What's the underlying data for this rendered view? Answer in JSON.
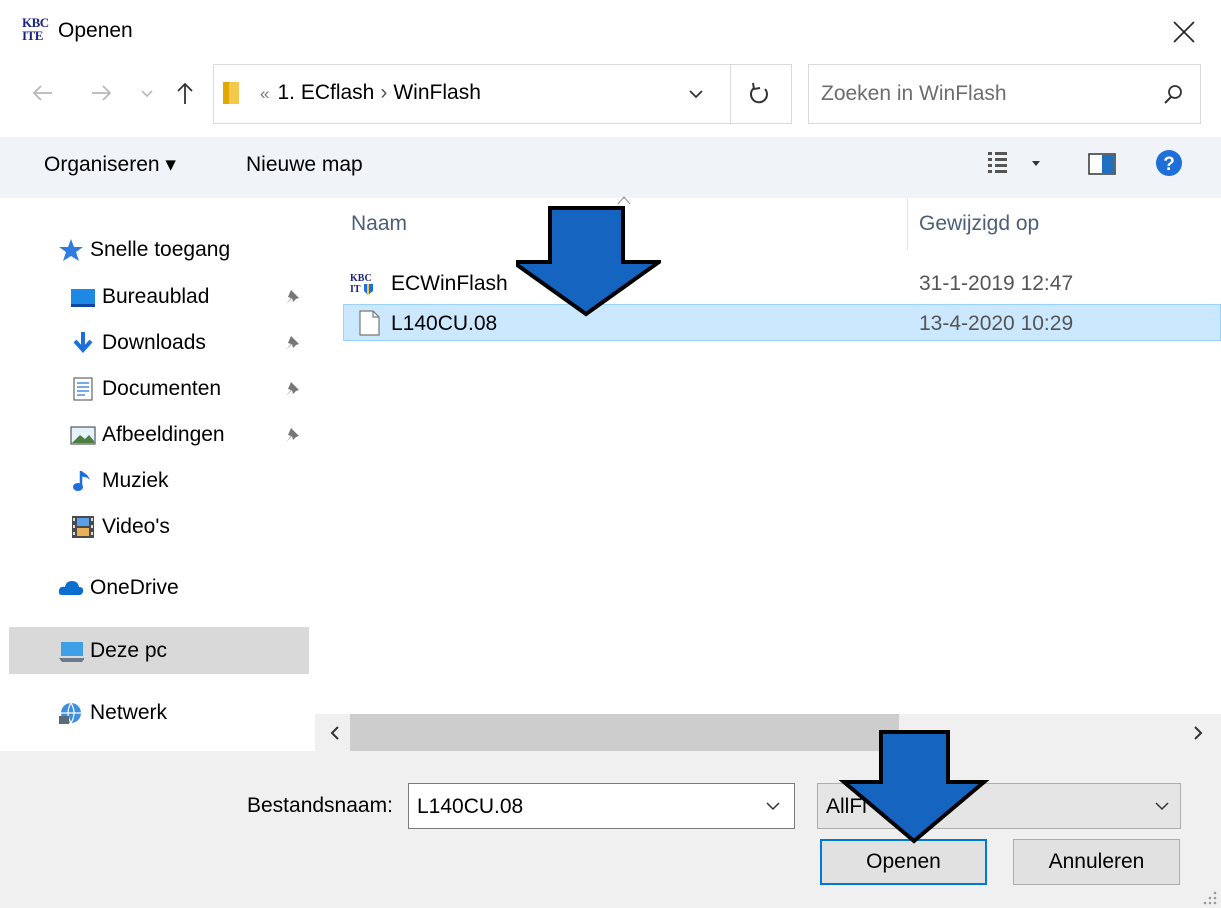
{
  "window": {
    "logo_text": [
      "KBC",
      "ITE"
    ],
    "title": "Openen",
    "close_label": "×"
  },
  "address": {
    "prefix": "«",
    "crumbs": [
      "1. ECflash",
      "WinFlash"
    ]
  },
  "search": {
    "placeholder": "Zoeken in WinFlash"
  },
  "toolbar": {
    "organise_label": "Organiseren ▾",
    "new_folder_label": "Nieuwe map"
  },
  "sidebar": {
    "items": [
      {
        "label": "Snelle toegang",
        "icon": "star-icon"
      },
      {
        "label": "Bureaublad",
        "icon": "desktop-icon",
        "pinned": true
      },
      {
        "label": "Downloads",
        "icon": "download-arrow-icon",
        "pinned": true
      },
      {
        "label": "Documenten",
        "icon": "document-icon",
        "pinned": true
      },
      {
        "label": "Afbeeldingen",
        "icon": "picture-icon",
        "pinned": true
      },
      {
        "label": "Muziek",
        "icon": "music-note-icon"
      },
      {
        "label": "Video's",
        "icon": "film-icon"
      },
      {
        "label": "OneDrive",
        "icon": "cloud-icon"
      },
      {
        "label": "Deze pc",
        "icon": "computer-icon",
        "selected": true
      },
      {
        "label": "Netwerk",
        "icon": "network-icon"
      }
    ]
  },
  "list": {
    "columns": [
      "Naam",
      "Gewijzigd op"
    ],
    "rows": [
      {
        "name": "ECWinFlash",
        "modified": "31-1-2019 12:47",
        "icon": "kbc-app-icon",
        "selected": false
      },
      {
        "name": "L140CU.08",
        "modified": "13-4-2020 10:29",
        "icon": "blank-file-icon",
        "selected": true
      }
    ]
  },
  "bottom": {
    "filename_label": "Bestandsnaam:",
    "filename_value": "L140CU.08",
    "filter_value": "AllFi",
    "open_label": "Openen",
    "cancel_label": "Annuleren"
  },
  "colors": {
    "arrow_fill": "#1565c0",
    "selection": "#cce8ff",
    "accent": "#0078d7"
  }
}
